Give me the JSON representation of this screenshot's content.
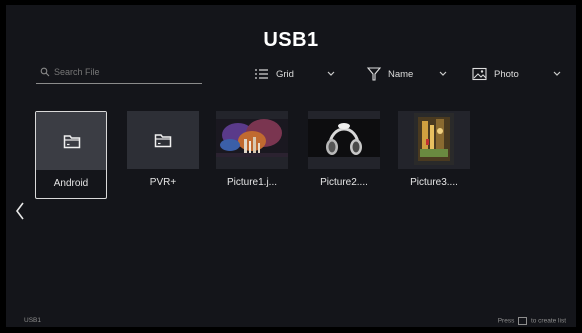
{
  "window": {
    "title": "USB1"
  },
  "search": {
    "placeholder": "Search File",
    "icon": "search-icon"
  },
  "view_dropdown": {
    "label": "Grid",
    "icon": "list-icon"
  },
  "sort_dropdown": {
    "label": "Name",
    "icon": "filter-icon"
  },
  "type_dropdown": {
    "label": "Photo",
    "icon": "photo-icon"
  },
  "items": [
    {
      "label": "Android",
      "kind": "folder"
    },
    {
      "label": "PVR+",
      "kind": "folder"
    },
    {
      "label": "Picture1.j...",
      "kind": "image"
    },
    {
      "label": "Picture2....",
      "kind": "image"
    },
    {
      "label": "Picture3....",
      "kind": "image"
    }
  ],
  "footer": {
    "source": "USB1",
    "hint_before": "Press",
    "hint_after": "to create list"
  },
  "colors": {
    "background": "#14151a",
    "tile": "#2d2f36",
    "selected_border": "#d9d9d9"
  }
}
